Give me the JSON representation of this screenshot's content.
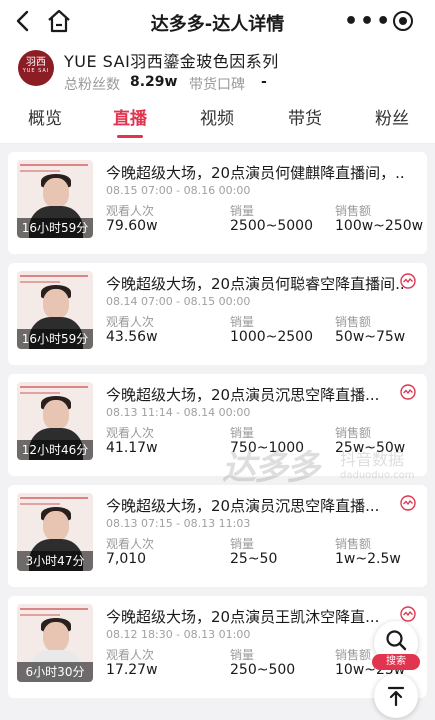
{
  "header": {
    "title": "达多多-达人详情",
    "more_glyph": "•••"
  },
  "profile": {
    "avatar_line1": "羽西",
    "avatar_line2": "YUE SAI",
    "name": "YUE SAI羽西鎏金玻色因系列",
    "fans_label": "总粉丝数",
    "fans_value": "8.29w",
    "reputation_label": "带货口碑",
    "reputation_value": "-"
  },
  "tabs": [
    {
      "label": "概览"
    },
    {
      "label": "直播"
    },
    {
      "label": "视频"
    },
    {
      "label": "带货"
    },
    {
      "label": "粉丝"
    }
  ],
  "active_tab": "直播",
  "metric_labels": {
    "views": "观看人次",
    "sales": "销量",
    "revenue": "销售额"
  },
  "live_list": [
    {
      "title": "今晚超级大场，20点演员何健麒降直播间，...",
      "time": "08.15 07:00 - 08.16 00:00",
      "duration": "16小时59分",
      "views": "79.60w",
      "sales": "2500~5000",
      "revenue": "100w~250w"
    },
    {
      "title": "今晚超级大场，20点演员何聪睿空降直播间...",
      "time": "08.14 07:00 - 08.15 00:00",
      "duration": "16小时59分",
      "views": "43.56w",
      "sales": "1000~2500",
      "revenue": "50w~75w"
    },
    {
      "title": "今晚超级大场，20点演员沉思空降直播...",
      "time": "08.13 11:14 - 08.14 00:00",
      "duration": "12小时46分",
      "views": "41.17w",
      "sales": "750~1000",
      "revenue": "25w~50w"
    },
    {
      "title": "今晚超级大场，20点演员沉思空降直播...",
      "time": "08.13 07:15 - 08.13 11:03",
      "duration": "3小时47分",
      "views": "7,010",
      "sales": "25~50",
      "revenue": "1w~2.5w"
    },
    {
      "title": "今晚超级大场，20点演员王凯沐空降直...",
      "time": "08.12 18:30 - 08.13 01:00",
      "duration": "6小时30分",
      "views": "17.27w",
      "sales": "250~500",
      "revenue": "10w~25w"
    }
  ],
  "fab": {
    "search_label": "搜索"
  },
  "watermark": {
    "brand": "达多多",
    "sub": "抖音数据",
    "url": "daduoduo.com"
  },
  "colors": {
    "accent": "#e0344f",
    "brand_avatar": "#8d1d25"
  }
}
